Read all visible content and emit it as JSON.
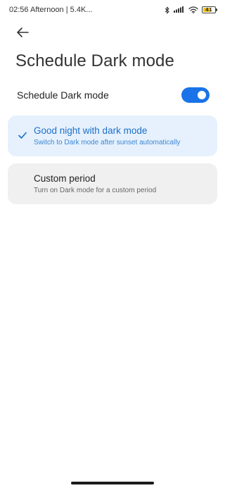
{
  "status_bar": {
    "time_text": "02:56 Afternoon | 5.4K...",
    "battery_level": "41",
    "icons": [
      "bluetooth-icon",
      "signal-icon",
      "wifi-icon",
      "battery-icon"
    ]
  },
  "header": {
    "back_icon": "back-arrow-icon",
    "title": "Schedule Dark mode"
  },
  "toggle": {
    "label": "Schedule Dark mode",
    "on": true
  },
  "options": [
    {
      "title": "Good night with dark mode",
      "subtitle": "Switch to Dark mode after sunset automatically",
      "selected": true,
      "icon": "checkmark-icon"
    },
    {
      "title": "Custom period",
      "subtitle": "Turn on Dark mode for a custom period",
      "selected": false
    }
  ],
  "colors": {
    "accent": "#1a73e8",
    "selected_card_bg": "#e6f1fd",
    "unselected_card_bg": "#f0f0f0",
    "selected_text": "#1d6fc9"
  }
}
